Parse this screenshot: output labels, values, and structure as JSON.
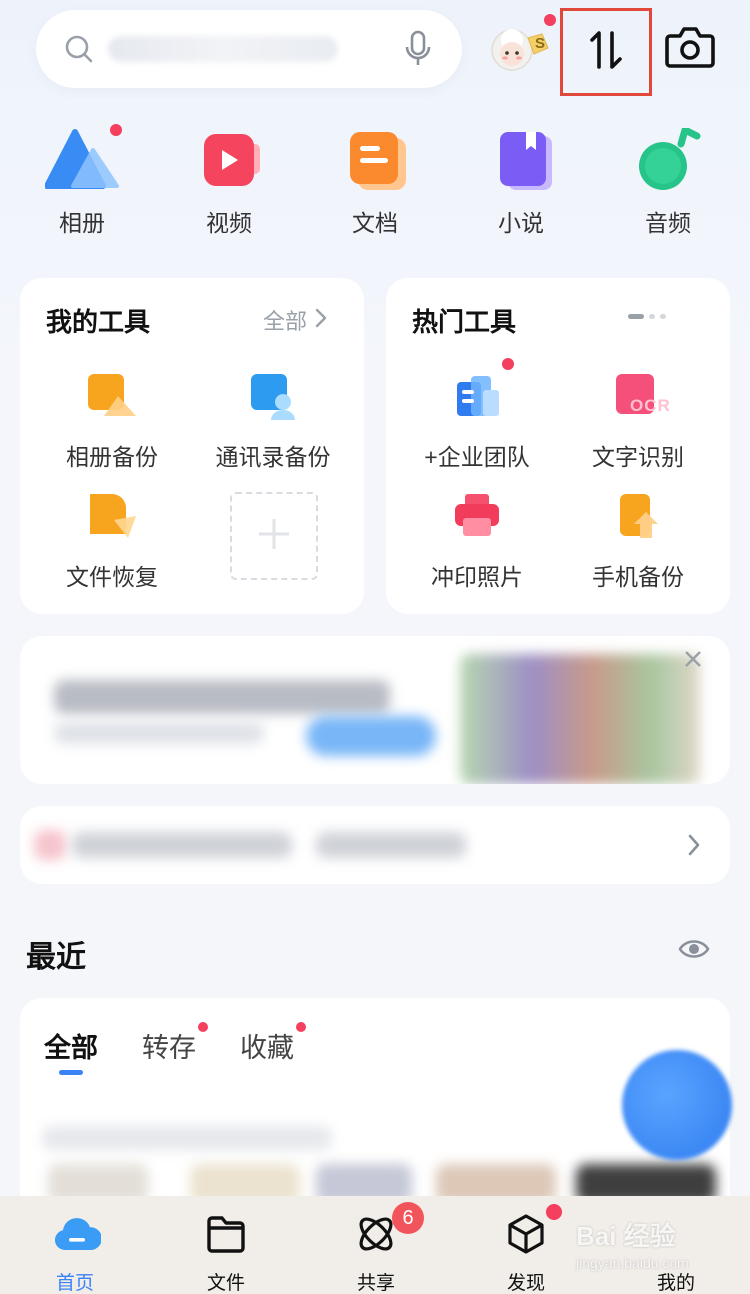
{
  "header": {
    "search_icon": "search-icon",
    "mic_icon": "microphone-icon",
    "avatar_badge": "S",
    "sort_icon": "transfer-sort-icon",
    "camera_icon": "camera-icon"
  },
  "categories": [
    {
      "label": "相册",
      "icon": "album-icon"
    },
    {
      "label": "视频",
      "icon": "video-icon"
    },
    {
      "label": "文档",
      "icon": "document-icon"
    },
    {
      "label": "小说",
      "icon": "novel-icon"
    },
    {
      "label": "音频",
      "icon": "audio-icon"
    }
  ],
  "my_tools": {
    "title": "我的工具",
    "all_label": "全部",
    "items": [
      {
        "label": "相册备份",
        "icon": "album-backup-icon"
      },
      {
        "label": "通讯录备份",
        "icon": "contacts-backup-icon"
      },
      {
        "label": "文件恢复",
        "icon": "file-recovery-icon"
      }
    ]
  },
  "hot_tools": {
    "title": "热门工具",
    "items": [
      {
        "label": "+企业团队",
        "icon": "enterprise-team-icon"
      },
      {
        "label": "文字识别",
        "icon": "ocr-icon",
        "badge_text": "OCR"
      },
      {
        "label": "冲印照片",
        "icon": "print-photo-icon"
      },
      {
        "label": "手机备份",
        "icon": "phone-backup-icon"
      }
    ]
  },
  "recent": {
    "title": "最近",
    "tabs": [
      "全部",
      "转存",
      "收藏"
    ]
  },
  "bottom_nav": [
    {
      "label": "首页",
      "icon": "home-cloud-icon"
    },
    {
      "label": "文件",
      "icon": "folder-icon"
    },
    {
      "label": "共享",
      "icon": "share-atom-icon",
      "badge": "6"
    },
    {
      "label": "发现",
      "icon": "discover-box-icon"
    },
    {
      "label": "我的",
      "icon": "profile-icon"
    }
  ],
  "watermark": {
    "text": "Bai 经验",
    "sub": "jingyan.baidu.com"
  },
  "colors": {
    "accent": "#3b82f6",
    "highlight_box": "#e0483c",
    "red_dot": "#f43f5e"
  }
}
